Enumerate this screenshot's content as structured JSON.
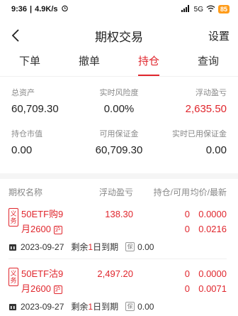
{
  "status_bar": {
    "time": "9:36",
    "net_speed": "4.9K/s",
    "signal": "5G",
    "battery": "85"
  },
  "nav": {
    "title": "期权交易",
    "settings_label": "设置"
  },
  "tabs": [
    {
      "label": "下单",
      "active": false
    },
    {
      "label": "撤单",
      "active": false
    },
    {
      "label": "持仓",
      "active": true
    },
    {
      "label": "查询",
      "active": false
    }
  ],
  "summary": {
    "total_assets_label": "总资产",
    "total_assets_value": "60,709.30",
    "risk_label": "实时风险度",
    "risk_value": "0.00%",
    "float_pl_label": "浮动盈亏",
    "float_pl_value": "2,635.50",
    "market_value_label": "持仓市值",
    "market_value_value": "0.00",
    "available_margin_label": "可用保证金",
    "available_margin_value": "60,709.30",
    "used_margin_label": "实时已用保证金",
    "used_margin_value": "0.00"
  },
  "positions_header": {
    "name": "期权名称",
    "float_pl": "浮动盈亏",
    "qty": "持仓/可用",
    "price": "均价/最新"
  },
  "positions": [
    {
      "tag": "义务",
      "name_line1": "50ETF购9",
      "name_line2": "月2600",
      "month_badge": "沪",
      "float_pl": "138.30",
      "qty_hold": "0",
      "qty_avail": "0",
      "avg_price": "0.0000",
      "last_price": "0.0216",
      "expiry": "2023-09-27",
      "remain_prefix": "剩余",
      "remain_days": "1",
      "remain_suffix": "日到期",
      "bao_label": "保",
      "margin": "0.00"
    },
    {
      "tag": "义务",
      "name_line1": "50ETF沽9",
      "name_line2": "月2600",
      "month_badge": "沪",
      "float_pl": "2,497.20",
      "qty_hold": "0",
      "qty_avail": "0",
      "avg_price": "0.0000",
      "last_price": "0.0071",
      "expiry": "2023-09-27",
      "remain_prefix": "剩余",
      "remain_days": "1",
      "remain_suffix": "日到期",
      "bao_label": "保",
      "margin": "0.00"
    }
  ]
}
